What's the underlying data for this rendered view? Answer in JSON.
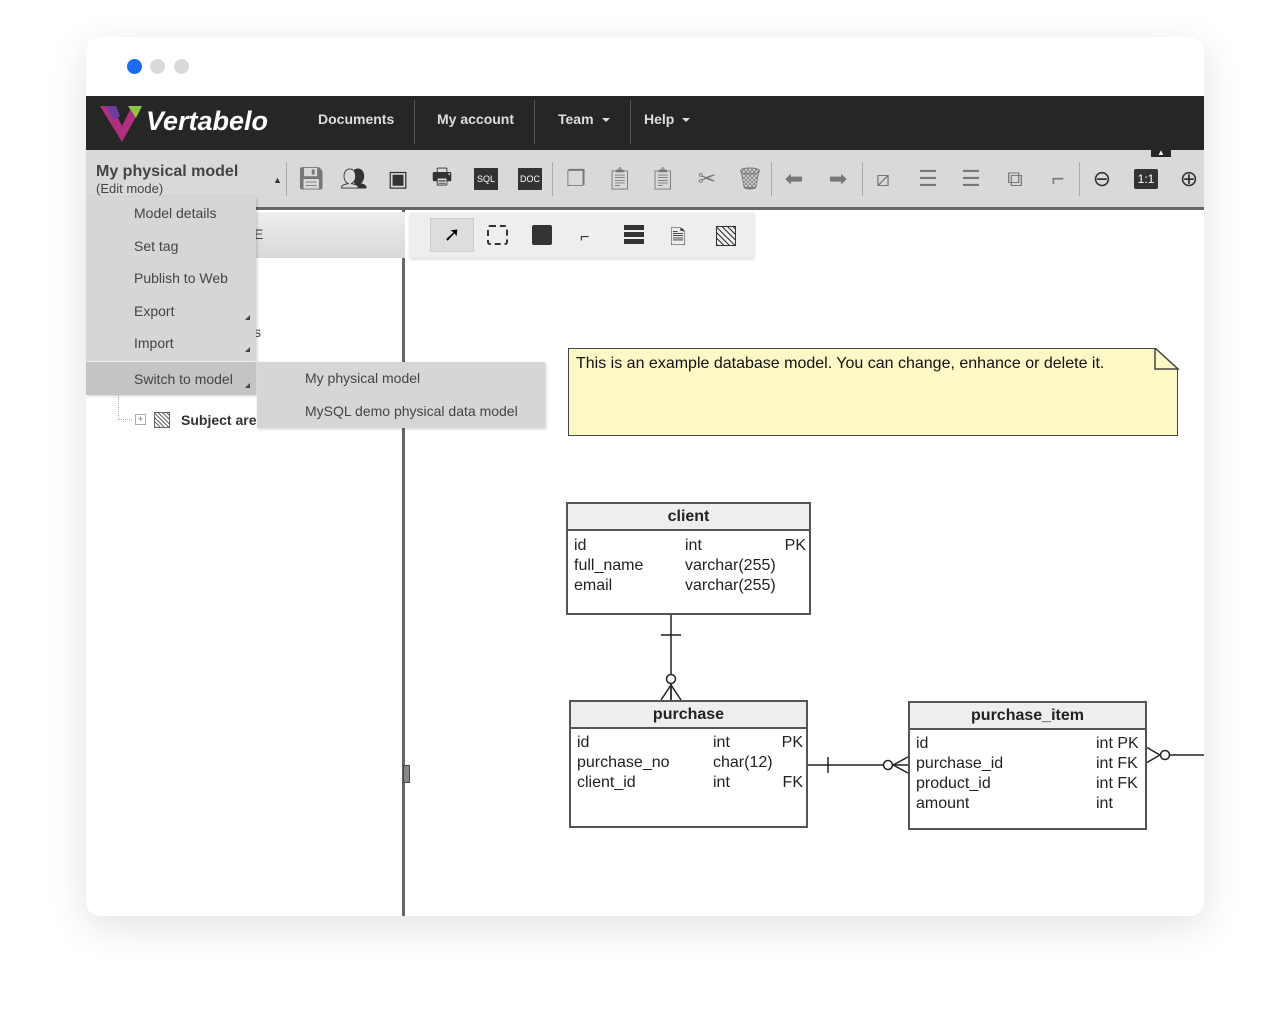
{
  "window": {
    "dots": [
      "#1a6cf0",
      "#d9d9d9",
      "#d9d9d9"
    ]
  },
  "nav": {
    "logo": "Vertabelo",
    "items": [
      {
        "label": "Documents"
      },
      {
        "label": "My account"
      },
      {
        "label": "Team",
        "dropdown": true
      },
      {
        "label": "Help",
        "dropdown": true
      }
    ]
  },
  "model": {
    "name": "My physical model",
    "mode": "(Edit mode)"
  },
  "toolbar": {
    "icons": [
      "save-icon",
      "team-icon",
      "image-icon",
      "print-icon",
      "sql-icon",
      "doc-icon",
      "copy-icon",
      "paste-icon",
      "paste-special-icon",
      "cut-icon",
      "delete-icon",
      "undo-icon",
      "redo-icon",
      "line-style-icon",
      "align-icon",
      "distribute-icon",
      "arrange-icon",
      "route-icon",
      "zoom-out-icon",
      "zoom-reset-icon",
      "zoom-in-icon"
    ],
    "zoom_reset_label": "1:1",
    "sql": "SQL",
    "doc": "DOC"
  },
  "menu": {
    "items": [
      "Model details",
      "Set tag",
      "Publish to Web",
      "Export",
      "Import",
      "Switch to model"
    ]
  },
  "submenu": {
    "items": [
      "My physical model",
      "MySQL demo physical data model"
    ]
  },
  "tree": {
    "header_fragment": "E",
    "fragment": "s",
    "subject_area": "Subject are"
  },
  "canvas_tools": [
    "select-icon",
    "marquee-icon",
    "table-icon",
    "reference-icon",
    "view-icon",
    "note-icon",
    "subject-area-icon"
  ],
  "note": {
    "text": "This is an example database model. You can change, enhance or delete it.",
    "color": "#fdf9c6"
  },
  "tables": {
    "client": {
      "name": "client",
      "rows": [
        [
          "id",
          "int",
          "PK"
        ],
        [
          "full_name",
          "varchar(255)",
          ""
        ],
        [
          "email",
          "varchar(255)",
          ""
        ]
      ]
    },
    "purchase": {
      "name": "purchase",
      "rows": [
        [
          "id",
          "int",
          "PK"
        ],
        [
          "purchase_no",
          "char(12)",
          ""
        ],
        [
          "client_id",
          "int",
          "FK"
        ]
      ]
    },
    "purchase_item": {
      "name": "purchase_item",
      "rows": [
        [
          "id",
          "int PK"
        ],
        [
          "purchase_id",
          "int FK"
        ],
        [
          "product_id",
          "int FK"
        ],
        [
          "amount",
          "int"
        ]
      ]
    }
  }
}
